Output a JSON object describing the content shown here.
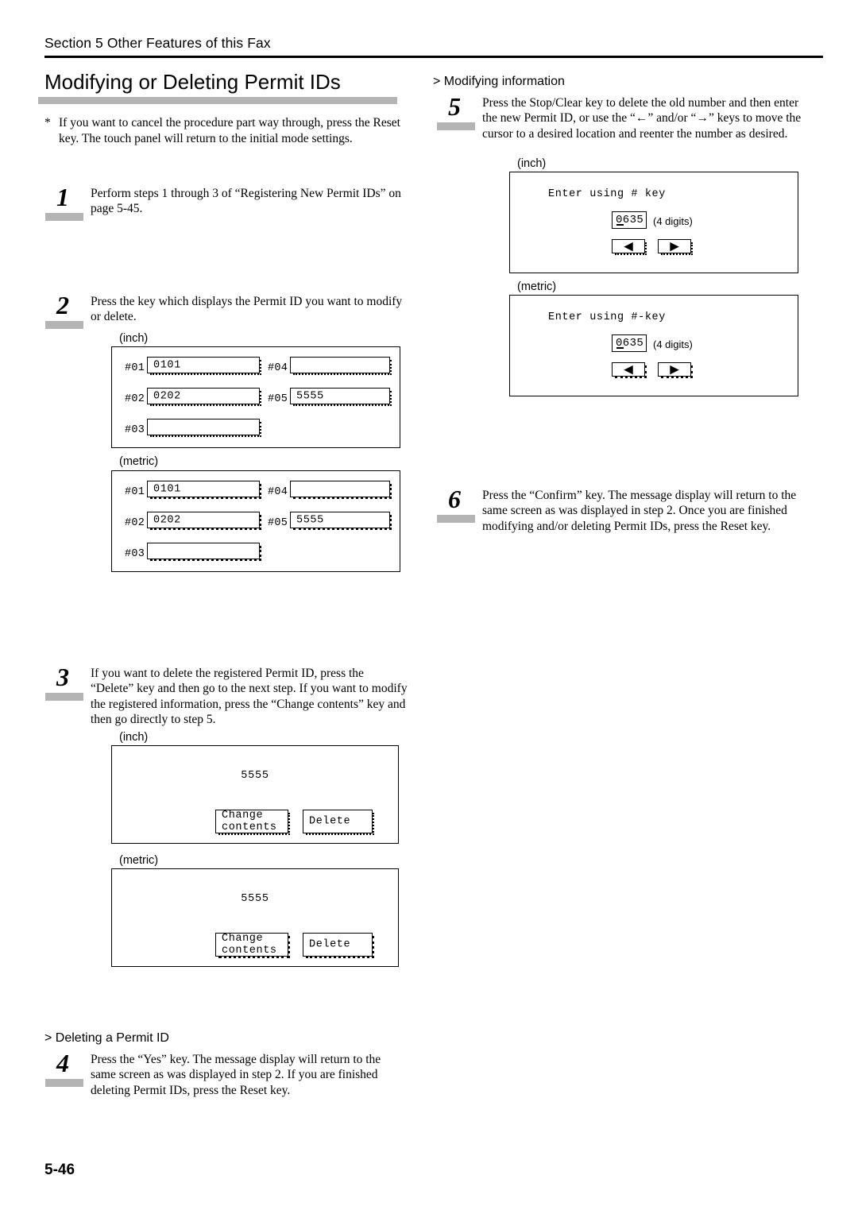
{
  "header": {
    "section": "Section 5  Other Features of this Fax"
  },
  "title": "Modifying or Deleting Permit IDs",
  "note": {
    "marker": "*",
    "text": "If you want to cancel the procedure part way through, press the Reset key. The touch panel will return to the initial mode settings."
  },
  "steps": {
    "one": {
      "number": "1",
      "text": "Perform steps 1 through 3 of “Registering New Permit IDs” on page 5-45."
    },
    "two": {
      "number": "2",
      "text": "Press the key which displays the Permit ID you want to modify or delete."
    },
    "three": {
      "number": "3",
      "text": "If you want to delete the registered Permit ID, press the “Delete” key and then go to the next step. If you want to modify the registered information, press the “Change contents” key and then go directly to step 5."
    },
    "four": {
      "number": "4",
      "text": "Press the “Yes” key. The message display will return to the same screen as was displayed in step 2. If you are finished deleting Permit IDs, press the Reset key."
    },
    "five": {
      "number": "5",
      "text": "Press the Stop/Clear key to delete the old number and then enter the new Permit ID, or use the “←” and/or “→” keys to move the cursor to a desired location and reenter the number as desired."
    },
    "six": {
      "number": "6",
      "text": "Press the “Confirm” key. The message display will return to the same screen as was displayed in step 2. Once you are finished modifying and/or deleting Permit IDs, press the Reset key."
    }
  },
  "subheads": {
    "modifying": "> Modifying information",
    "deleting": "> Deleting a Permit ID"
  },
  "panel_labels": {
    "inch": "(inch)",
    "metric": "(metric)"
  },
  "permit_id_list": {
    "rows": [
      {
        "label": "#01",
        "value": "0101"
      },
      {
        "label": "#02",
        "value": "0202"
      },
      {
        "label": "#03",
        "value": ""
      },
      {
        "label": "#04",
        "value": ""
      },
      {
        "label": "#05",
        "value": "5555"
      }
    ]
  },
  "select_action_panel": {
    "permit_id": "5555",
    "change_button_line1": "Change",
    "change_button_line2": "contents",
    "delete_button": "Delete"
  },
  "entry_panel_inch": {
    "prompt": "Enter using # key",
    "value": "0635",
    "digits_note": "(4 digits)",
    "left_arrow": "◀",
    "right_arrow": "▶"
  },
  "entry_panel_metric": {
    "prompt": "Enter using #-key",
    "value": "0635",
    "digits_note": "(4 digits)",
    "left_arrow": "◀",
    "right_arrow": "▶"
  },
  "page_number": "5-46",
  "colors": {
    "rule": "#000000",
    "accent_bar": "#b4b4b4"
  }
}
